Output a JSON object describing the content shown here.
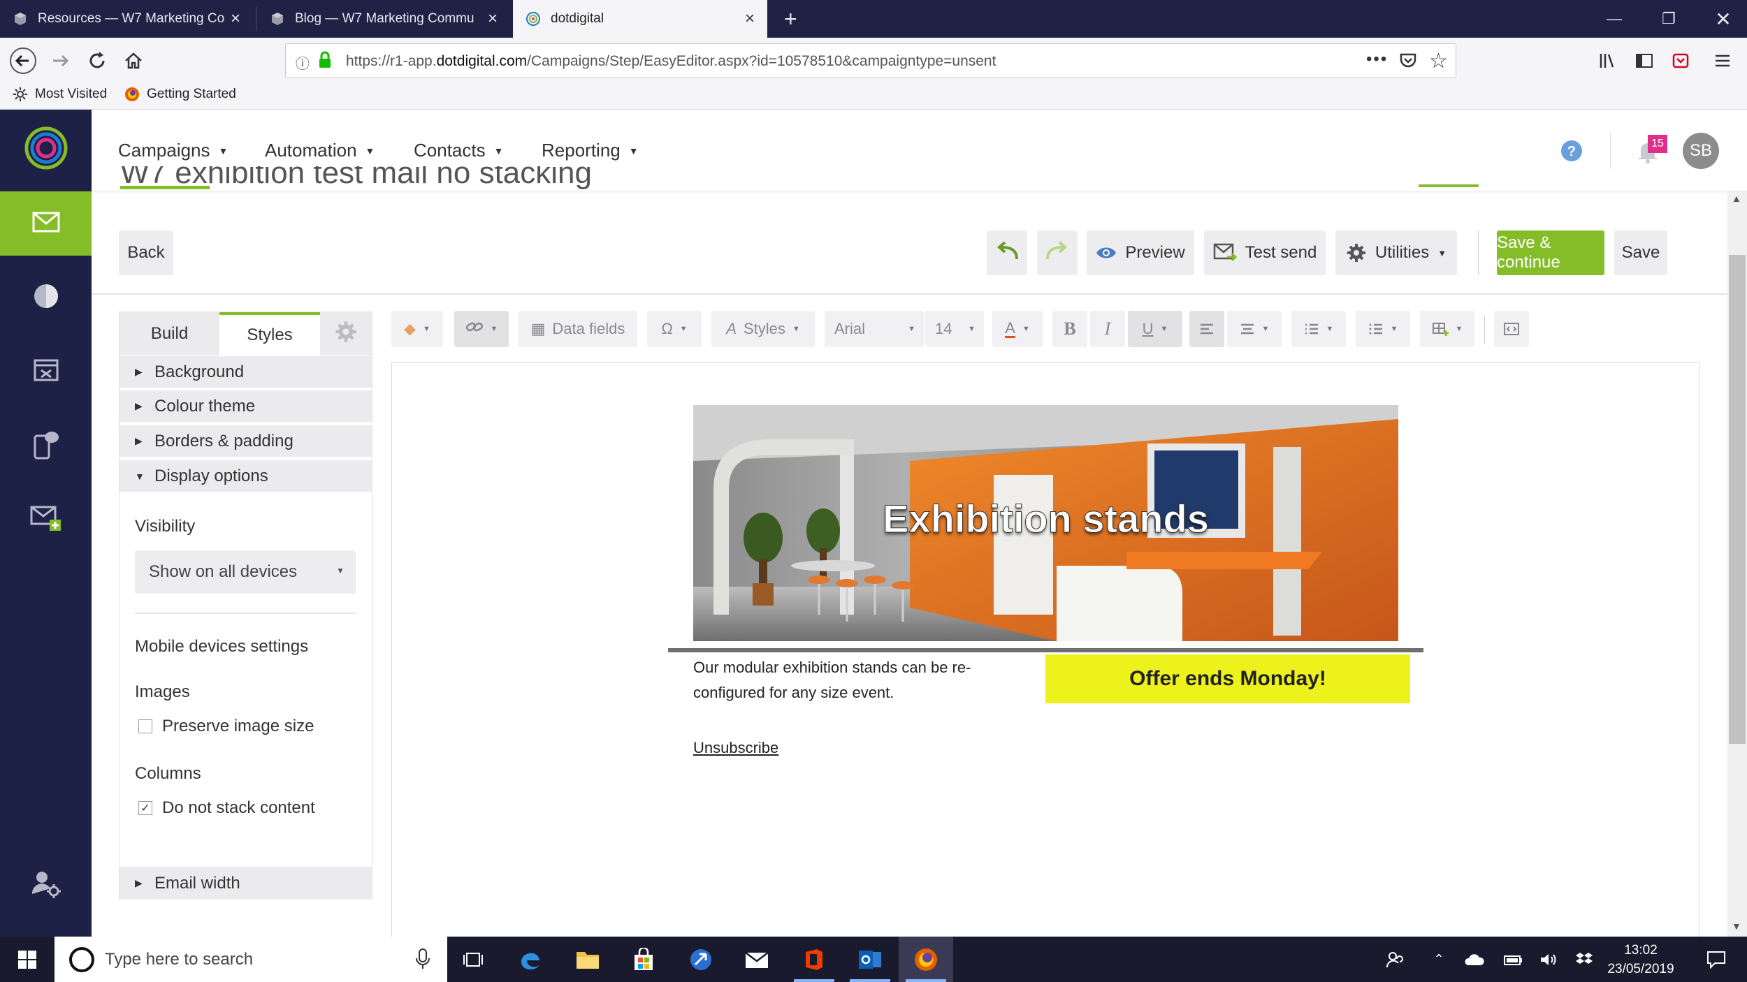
{
  "browser": {
    "tabs": [
      {
        "title": "Resources — W7 Marketing Co",
        "icon": "cube-icon"
      },
      {
        "title": "Blog — W7 Marketing Commu",
        "icon": "cube-icon"
      },
      {
        "title": "dotdigital",
        "icon": "dotdigital-icon"
      }
    ],
    "url_prefix": "https://r1-app.",
    "url_domain": "dotdigital.com",
    "url_path": "/Campaigns/Step/EasyEditor.aspx?id=10578510&campaigntype=unsent",
    "bookmarks": [
      "Most Visited",
      "Getting Started"
    ]
  },
  "app": {
    "menu": [
      "Campaigns",
      "Automation",
      "Contacts",
      "Reporting"
    ],
    "notification_count": "15",
    "avatar_initials": "SB",
    "campaign_title": "W7 exhibition test mail no stacking",
    "accent_color": "#84bd27",
    "sidebar_bg": "#1e2146"
  },
  "toolbar": {
    "back": "Back",
    "preview": "Preview",
    "test_send": "Test send",
    "utilities": "Utilities",
    "save_continue": "Save & continue",
    "save": "Save"
  },
  "panel": {
    "tabs": [
      "Build",
      "Styles"
    ],
    "sections": [
      "Background",
      "Colour theme",
      "Borders & padding",
      "Display options",
      "Email width"
    ],
    "visibility_label": "Visibility",
    "visibility_value": "Show on all devices",
    "mobile_settings_label": "Mobile devices settings",
    "images_label": "Images",
    "preserve_image_size": "Preserve image size",
    "preserve_checked": false,
    "columns_label": "Columns",
    "do_not_stack": "Do not stack content",
    "do_not_stack_checked": true
  },
  "editor_toolbar": {
    "data_fields": "Data fields",
    "styles": "Styles",
    "font": "Arial",
    "size": "14"
  },
  "email": {
    "hero_title": "Exhibition stands",
    "body_text": "Our modular exhibition stands can be re-configured for any size event.",
    "offer": "Offer ends Monday!",
    "offer_color": "#eef21c",
    "unsubscribe": "Unsubscribe"
  },
  "taskbar": {
    "search_placeholder": "Type here to search",
    "time": "13:02",
    "date": "23/05/2019"
  }
}
